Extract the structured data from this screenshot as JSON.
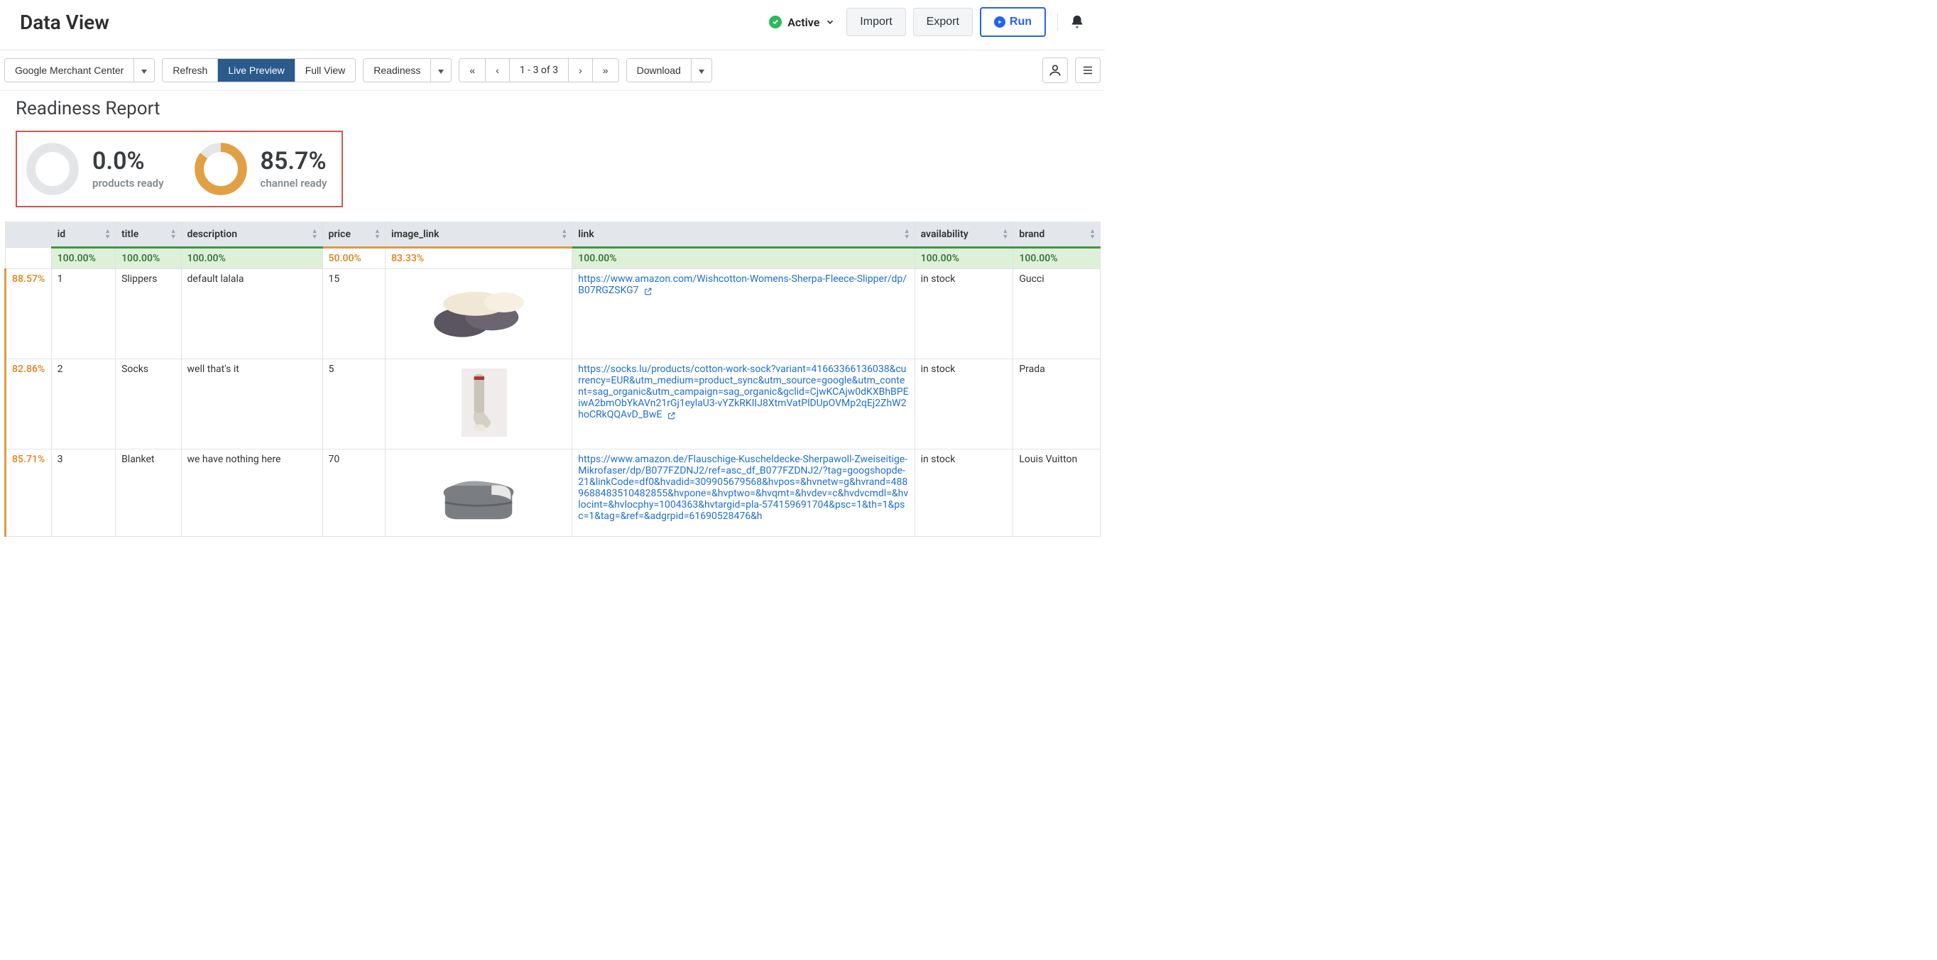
{
  "header": {
    "title": "Data View",
    "status_label": "Active",
    "import_label": "Import",
    "export_label": "Export",
    "run_label": "Run"
  },
  "toolbar": {
    "channel": "Google Merchant Center",
    "refresh": "Refresh",
    "live_preview": "Live Preview",
    "full_view": "Full View",
    "readiness": "Readiness",
    "page_indicator": "1 - 3 of 3",
    "download": "Download",
    "pager": {
      "first": "«",
      "prev": "‹",
      "next": "›",
      "last": "»"
    }
  },
  "report": {
    "title": "Readiness Report",
    "products_ready_pct": "0.0%",
    "products_ready_label": "products ready",
    "products_ready_value": 0.0,
    "channel_ready_pct": "85.7%",
    "channel_ready_label": "channel ready",
    "channel_ready_value": 85.7
  },
  "table": {
    "columns": {
      "id": "id",
      "title": "title",
      "description": "description",
      "price": "price",
      "image_link": "image_link",
      "link": "link",
      "availability": "availability",
      "brand": "brand"
    },
    "column_pct": {
      "id": "100.00%",
      "title": "100.00%",
      "description": "100.00%",
      "price": "50.00%",
      "image_link": "83.33%",
      "link": "100.00%",
      "availability": "100.00%",
      "brand": "100.00%"
    },
    "rows": [
      {
        "row_pct": "88.57%",
        "id": "1",
        "title": "Slippers",
        "description": "default lalala",
        "price": "15",
        "link": "https://www.amazon.com/Wishcotton-Womens-Sherpa-Fleece-Slipper/dp/B07RGZSKG7",
        "availability": "in stock",
        "brand": "Gucci"
      },
      {
        "row_pct": "82.86%",
        "id": "2",
        "title": "Socks",
        "description": "well that's it",
        "price": "5",
        "link": "https://socks.lu/products/cotton-work-sock?variant=41663366136038&currency=EUR&utm_medium=product_sync&utm_source=google&utm_content=sag_organic&utm_campaign=sag_organic&gclid=CjwKCAjw0dKXBhBPEiwA2bmObYkAVn21rGj1eylaU3-vYZkRKIIJ8XtmVatPlDUpOVMp2qEj2ZhW2hoCRkQQAvD_BwE",
        "availability": "in stock",
        "brand": "Prada"
      },
      {
        "row_pct": "85.71%",
        "id": "3",
        "title": "Blanket",
        "description": "we have nothing here",
        "price": "70",
        "link": "https://www.amazon.de/Flauschige-Kuscheldecke-Sherpawoll-Zweiseitige-Mikrofaser/dp/B077FZDNJ2/ref=asc_df_B077FZDNJ2/?tag=googshopde-21&linkCode=df0&hvadid=309905679568&hvpos=&hvnetw=g&hvrand=4889688483510482855&hvpone=&hvptwo=&hvqmt=&hvdev=c&hvdvcmdl=&hvlocint=&hvlocphy=1004363&hvtargid=pla-574159691704&psc=1&th=1&psc=1&tag=&ref=&adgrpid=61690528476&h",
        "availability": "in stock",
        "brand": "Louis Vuitton"
      }
    ]
  }
}
